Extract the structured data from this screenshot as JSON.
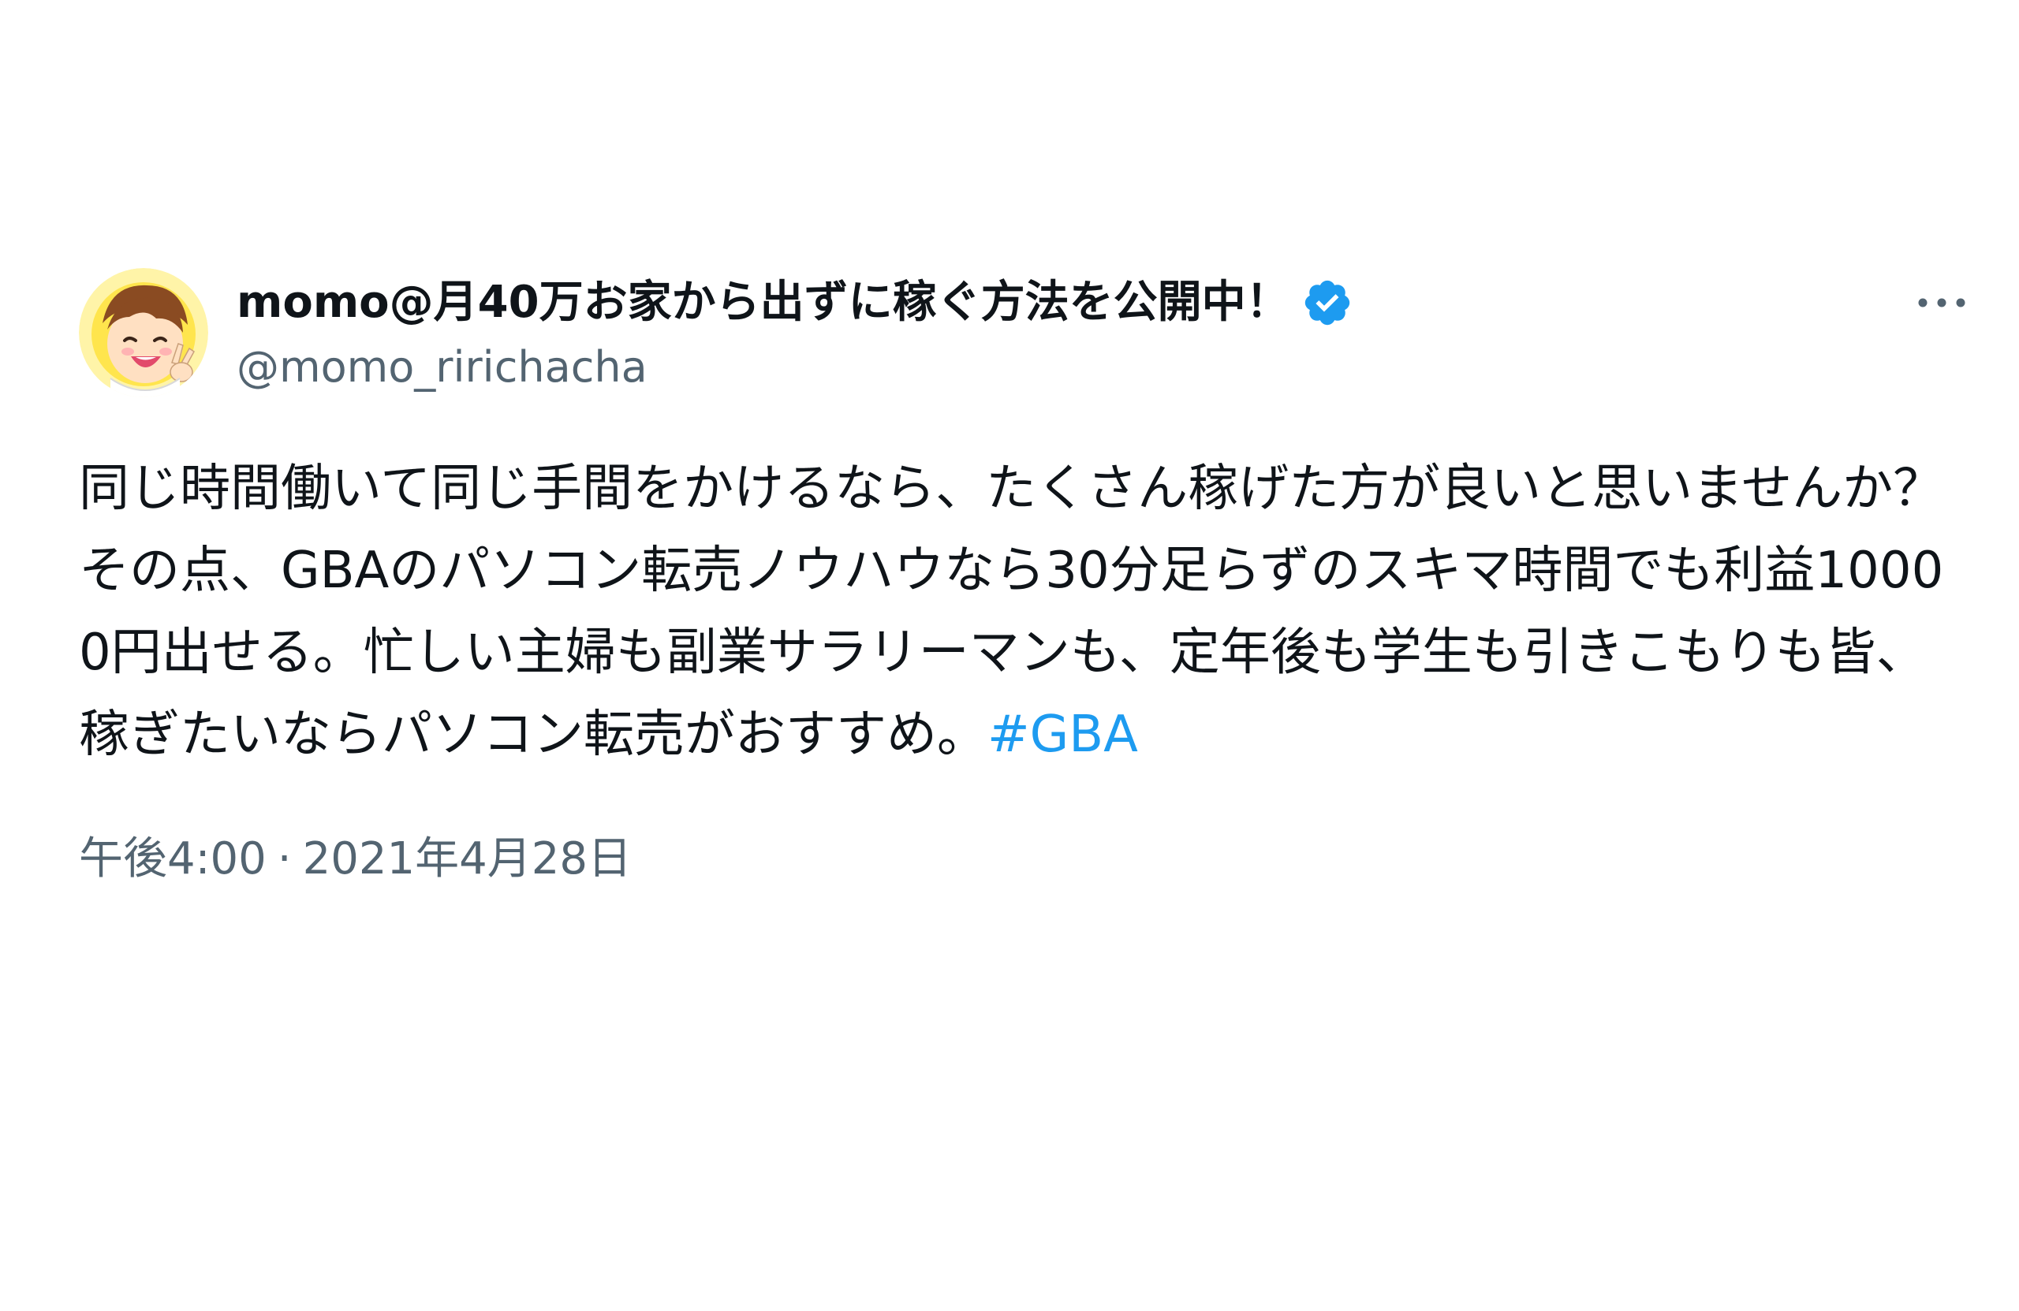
{
  "author": {
    "display_name": "momo@月40万お家から出ずに稼ぐ方法を公開中！",
    "handle": "@momo_ririchacha",
    "verified": true,
    "avatar_icon": "cartoon-avatar-icon",
    "verified_icon": "verified-badge-icon",
    "verified_color": "#1d9bf0"
  },
  "tweet": {
    "text": "同じ時間働いて同じ手間をかけるなら、たくさん稼げた方が良いと思いませんか？その点、GBAのパソコン転売ノウハウなら30分足らずのスキマ時間でも利益10000円出せる。忙しい主婦も副業サラリーマンも、定年後も学生も引きこもりも皆、稼ぎたいならパソコン転売がおすすめ。",
    "hashtag": "#GBA",
    "time": "午後4:00",
    "separator": "·",
    "date": "2021年4月28日"
  },
  "actions": {
    "more_icon": "more-options-icon"
  },
  "colors": {
    "text": "#0f1419",
    "secondary": "#536471",
    "link": "#1d9bf0"
  }
}
